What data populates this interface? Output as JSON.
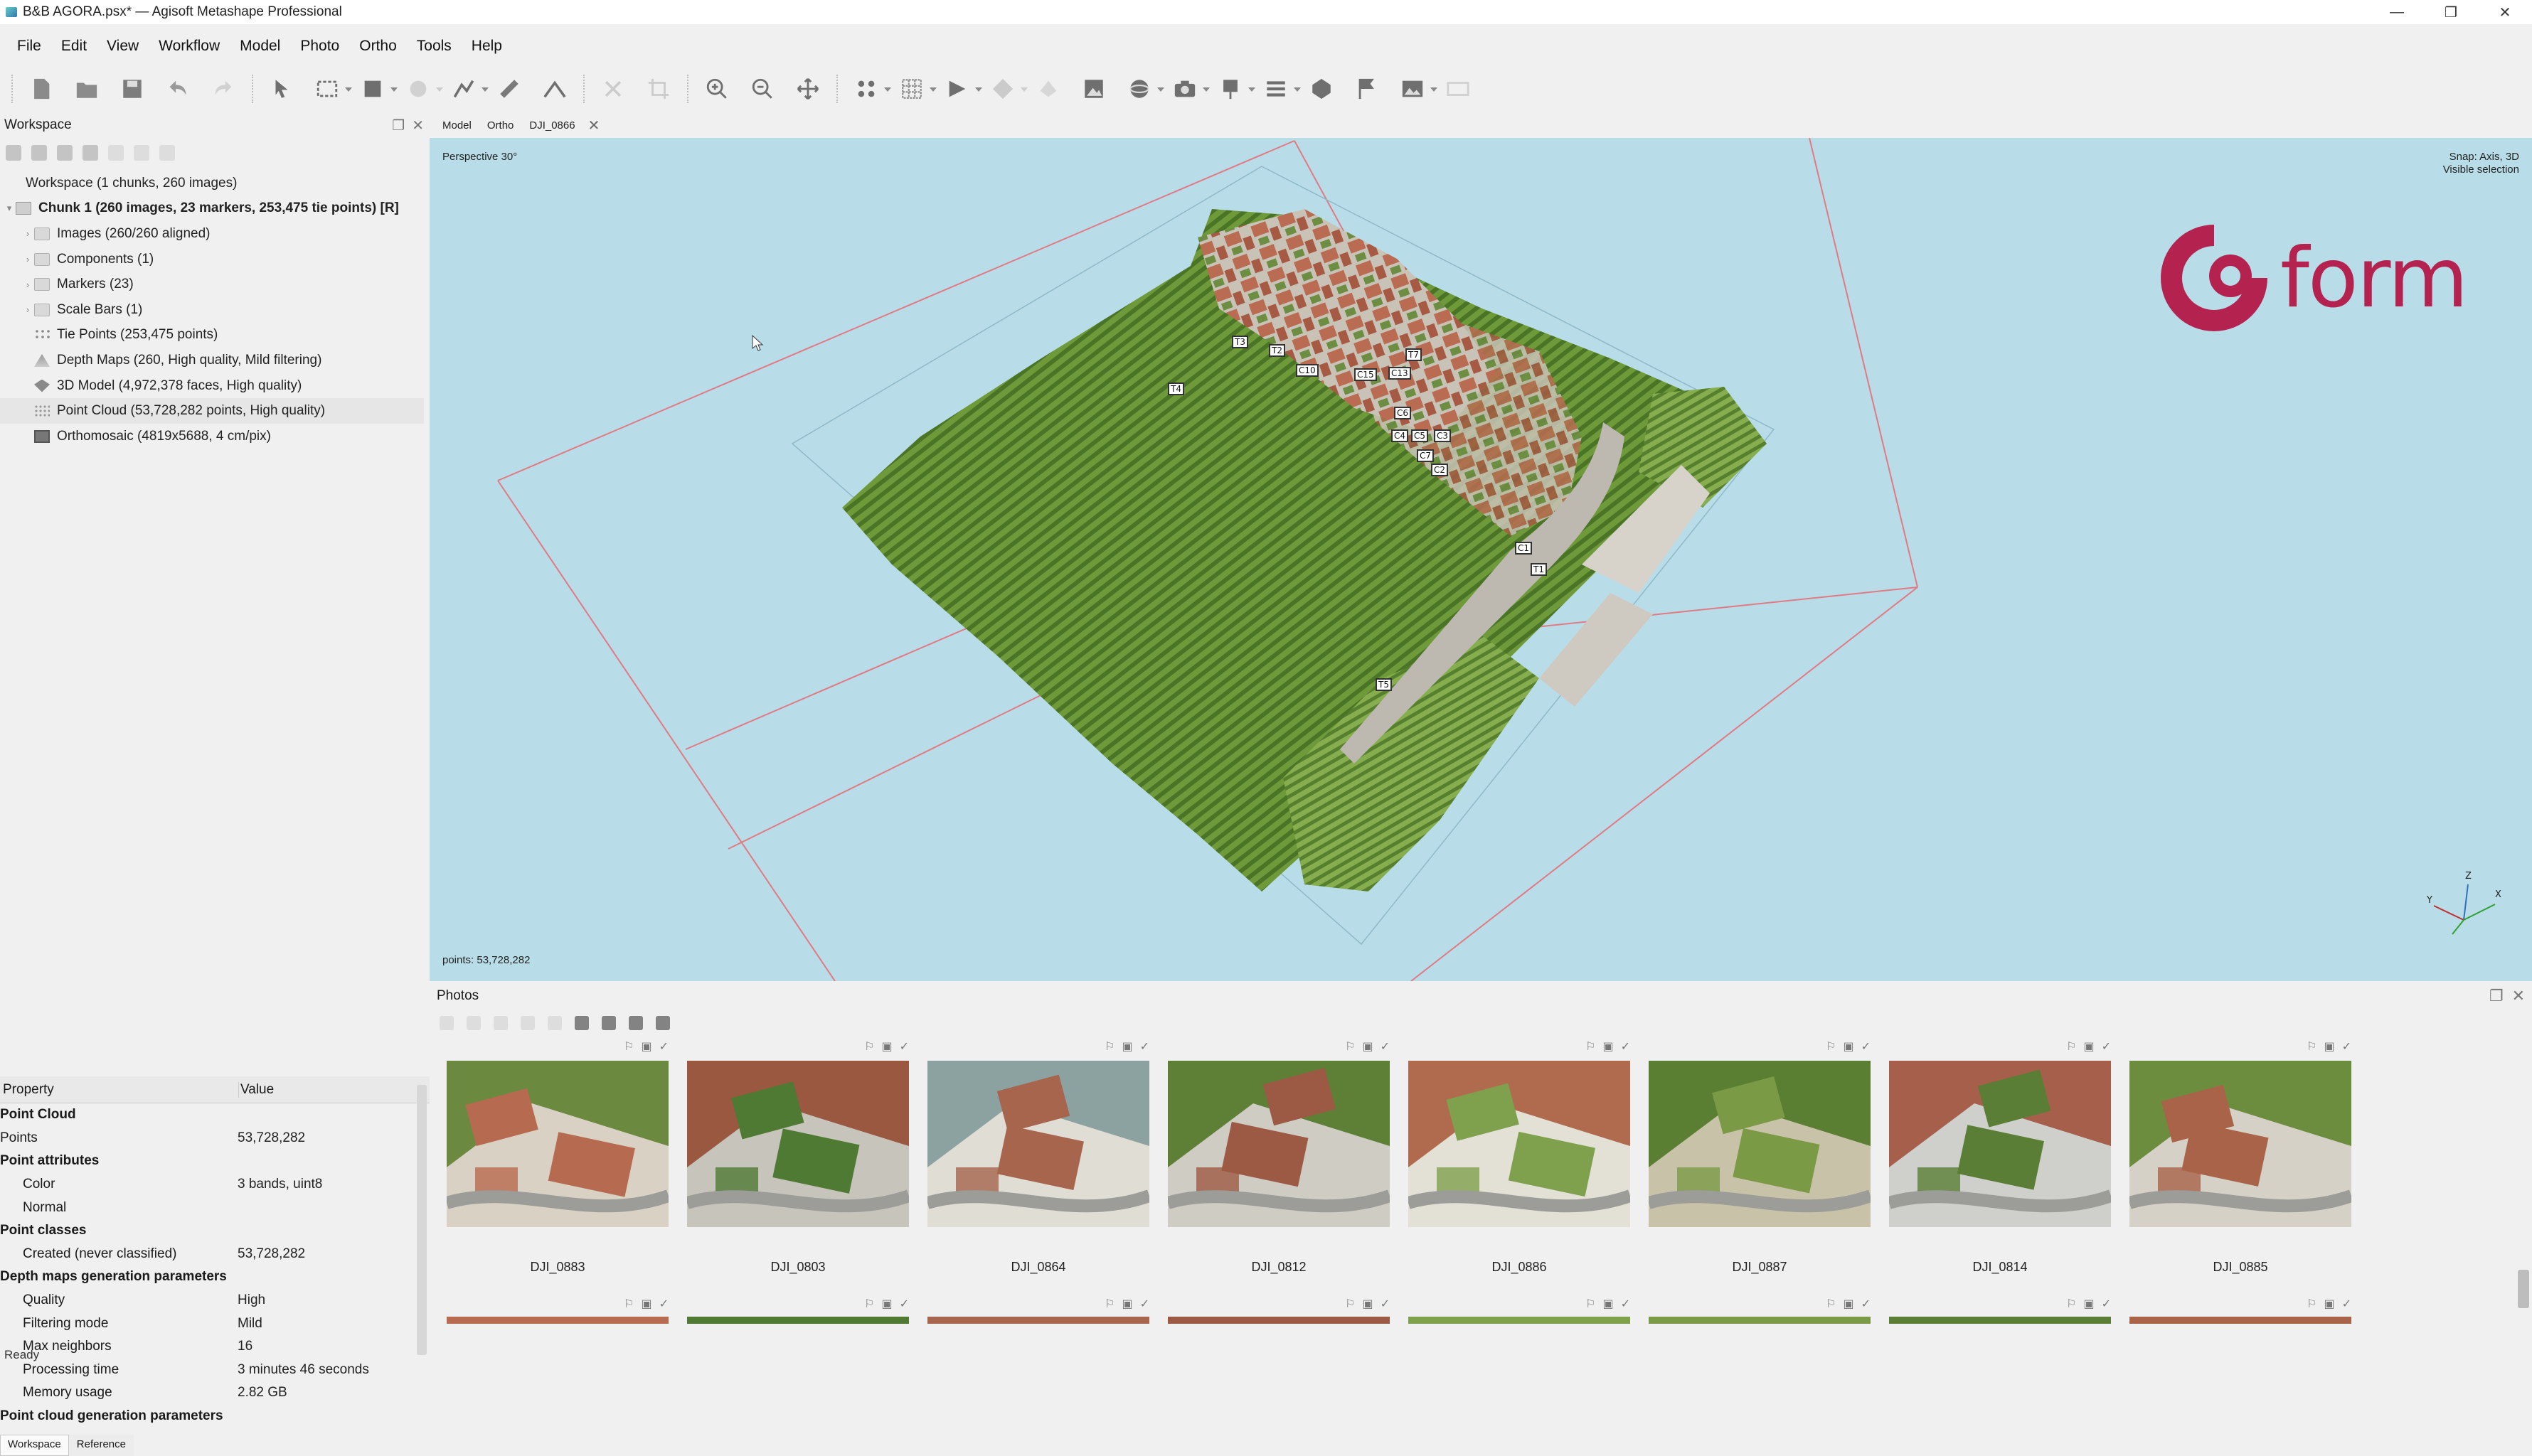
{
  "window": {
    "title": "B&B AGORA.psx* — Agisoft Metashape Professional",
    "controls": [
      "—",
      "❐",
      "✕"
    ]
  },
  "menu": [
    "File",
    "Edit",
    "View",
    "Workflow",
    "Model",
    "Photo",
    "Ortho",
    "Tools",
    "Help"
  ],
  "toolbar": {
    "icons": [
      "new-icon",
      "open-icon",
      "save-icon",
      "undo-icon",
      "redo-icon",
      "select-icon",
      "rect-select-icon",
      "shape-icon",
      "paint-icon",
      "draw-polyline-icon",
      "ruler-icon",
      "line-icon",
      "delete-icon",
      "crop-icon",
      "zoom-in-icon",
      "zoom-out-icon",
      "move-icon",
      "show-points-icon",
      "grid-icon",
      "show-model-icon",
      "show-shaded-icon",
      "texture-icon",
      "orthomosaic-icon",
      "sphere-icon",
      "camera-icon",
      "markers-icon",
      "list-icon",
      "region-icon",
      "flag-icon",
      "image-icon",
      "fit-icon"
    ]
  },
  "workspace": {
    "title": "Workspace",
    "tree": [
      {
        "label": "Workspace (1 chunks, 260 images)",
        "level": 0,
        "icon": "workspace-icon"
      },
      {
        "label": "Chunk 1 (260 images, 23 markers, 253,475 tie points) [R]",
        "level": 1,
        "icon": "chunk-icon",
        "bold": true
      },
      {
        "label": "Images (260/260 aligned)",
        "level": 2,
        "icon": "folder-icon"
      },
      {
        "label": "Components (1)",
        "level": 2,
        "icon": "folder-icon"
      },
      {
        "label": "Markers (23)",
        "level": 2,
        "icon": "folder-icon"
      },
      {
        "label": "Scale Bars (1)",
        "level": 2,
        "icon": "folder-icon"
      },
      {
        "label": "Tie Points (253,475 points)",
        "level": 2,
        "icon": "tie-icon"
      },
      {
        "label": "Depth Maps (260, High quality, Mild filtering)",
        "level": 2,
        "icon": "depth-icon"
      },
      {
        "label": "3D Model (4,972,378 faces, High quality)",
        "level": 2,
        "icon": "model-icon"
      },
      {
        "label": "Point Cloud (53,728,282 points, High quality)",
        "level": 2,
        "icon": "cloud-icon"
      },
      {
        "label": "Orthomosaic (4819x5688, 4 cm/pix)",
        "level": 2,
        "icon": "ortho-icon"
      }
    ]
  },
  "properties": {
    "header": {
      "property": "Property",
      "value": "Value"
    },
    "rows": [
      {
        "k": "Point Cloud",
        "v": "",
        "t": "grp"
      },
      {
        "k": "Points",
        "v": "53,728,282",
        "t": "row"
      },
      {
        "k": "Point attributes",
        "v": "",
        "t": "grp"
      },
      {
        "k": "Color",
        "v": "3 bands, uint8",
        "t": "sub"
      },
      {
        "k": "Normal",
        "v": "",
        "t": "sub"
      },
      {
        "k": "Point classes",
        "v": "",
        "t": "grp"
      },
      {
        "k": "Created (never classified)",
        "v": "53,728,282",
        "t": "sub"
      },
      {
        "k": "Depth maps generation parameters",
        "v": "",
        "t": "grp"
      },
      {
        "k": "Quality",
        "v": "High",
        "t": "sub"
      },
      {
        "k": "Filtering mode",
        "v": "Mild",
        "t": "sub"
      },
      {
        "k": "Max neighbors",
        "v": "16",
        "t": "sub"
      },
      {
        "k": "Processing time",
        "v": "3 minutes 46 seconds",
        "t": "sub"
      },
      {
        "k": "Memory usage",
        "v": "2.82 GB",
        "t": "sub"
      },
      {
        "k": "Point cloud generation parameters",
        "v": "",
        "t": "grp"
      }
    ]
  },
  "left_tabs": [
    "Workspace",
    "Reference"
  ],
  "status": "Ready",
  "doc_tabs": [
    "Model",
    "Ortho",
    "DJI_0866"
  ],
  "viewport": {
    "projection": "Perspective 30°",
    "snap": "Snap: Axis, 3D",
    "selection": "Visible selection",
    "points": "points: 53,728,282",
    "logo_text": "form",
    "markers": [
      "T3",
      "T2",
      "T4",
      "C10",
      "C15",
      "C13",
      "T7",
      "C6",
      "C3",
      "C4",
      "C5",
      "C7",
      "C2",
      "C1",
      "T1",
      "T5"
    ],
    "axes": [
      "Y",
      "Z",
      "X"
    ]
  },
  "photos": {
    "title": "Photos",
    "items": [
      {
        "label": "DJI_0883",
        "palette": [
          "#b66a4f",
          "#6b8a3f",
          "#d9d2c4"
        ]
      },
      {
        "label": "DJI_0803",
        "palette": [
          "#4f7a34",
          "#9a5840",
          "#c7c4bc"
        ]
      },
      {
        "label": "DJI_0864",
        "palette": [
          "#a6654c",
          "#8ca2a0",
          "#e0ddd5"
        ]
      },
      {
        "label": "DJI_0812",
        "palette": [
          "#9c5a44",
          "#5d8036",
          "#cfccc4"
        ]
      },
      {
        "label": "DJI_0886",
        "palette": [
          "#7fa04c",
          "#b06a4e",
          "#e3e0d6"
        ]
      },
      {
        "label": "DJI_0887",
        "palette": [
          "#7b9a45",
          "#5b7f32",
          "#c8c2a8"
        ]
      },
      {
        "label": "DJI_0814",
        "palette": [
          "#5a7e35",
          "#a65f4a",
          "#cfd0cb"
        ]
      },
      {
        "label": "DJI_0885",
        "palette": [
          "#a96348",
          "#6c8d3e",
          "#d6d1c6"
        ]
      }
    ]
  },
  "colors": {
    "accent": "#b4234f",
    "viewport_bg": "#b9dde8",
    "region_lines": "#e07a84"
  }
}
